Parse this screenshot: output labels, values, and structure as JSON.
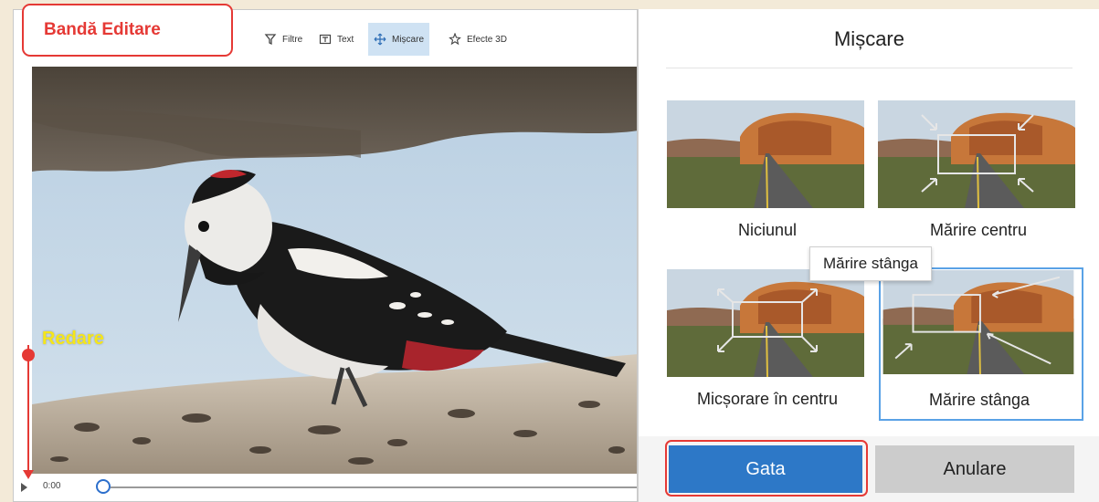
{
  "editor": {
    "band_label": "Bandă Editare",
    "toolbar": [
      {
        "label": "Filtre",
        "icon": "filter-icon"
      },
      {
        "label": "Text",
        "icon": "text-icon"
      },
      {
        "label": "Mișcare",
        "icon": "motion-icon"
      },
      {
        "label": "Efecte 3D",
        "icon": "effects-3d-icon"
      }
    ],
    "redare_label": "Redare",
    "time": "0:00"
  },
  "panel": {
    "title": "Mișcare",
    "options": [
      {
        "label": "Niciunul"
      },
      {
        "label": "Mărire centru"
      },
      {
        "label": "Micșorare în centru"
      },
      {
        "label": "Mărire stânga"
      }
    ],
    "tooltip": "Mărire stânga",
    "done_label": "Gata",
    "cancel_label": "Anulare"
  },
  "colors": {
    "accent": "#2d78c7",
    "highlight": "#e53935",
    "annotation_yellow": "#f5e61a",
    "selected_border": "#5aa2e6"
  }
}
